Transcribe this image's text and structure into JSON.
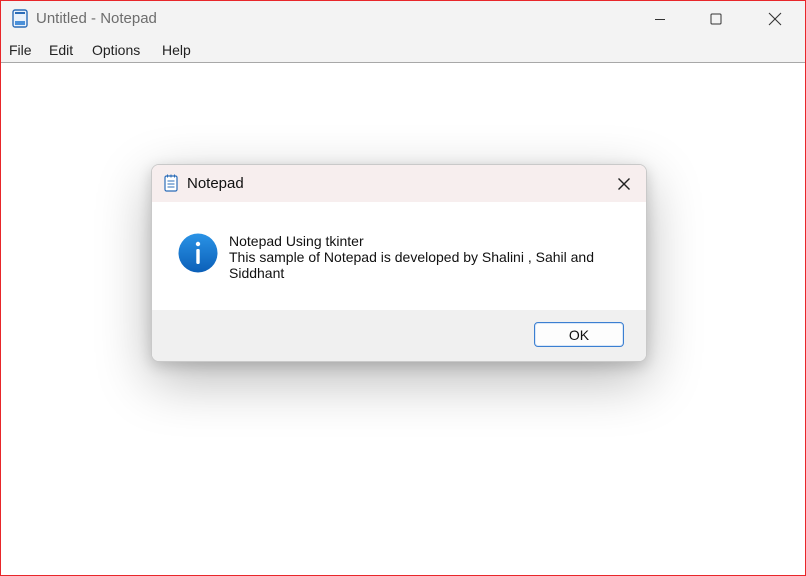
{
  "window": {
    "title": "Untitled - Notepad",
    "border_color": "#e8262a"
  },
  "menu": {
    "file": "File",
    "edit": "Edit",
    "options": "Options",
    "help": "Help"
  },
  "editor": {
    "content": ""
  },
  "dialog": {
    "title": "Notepad",
    "message_title": "Notepad Using tkinter",
    "message_body": "This sample of Notepad is developed by Shalini , Sahil and Siddhant",
    "ok_label": "OK",
    "icon": "info-icon",
    "accent_color": "#1976d2"
  }
}
